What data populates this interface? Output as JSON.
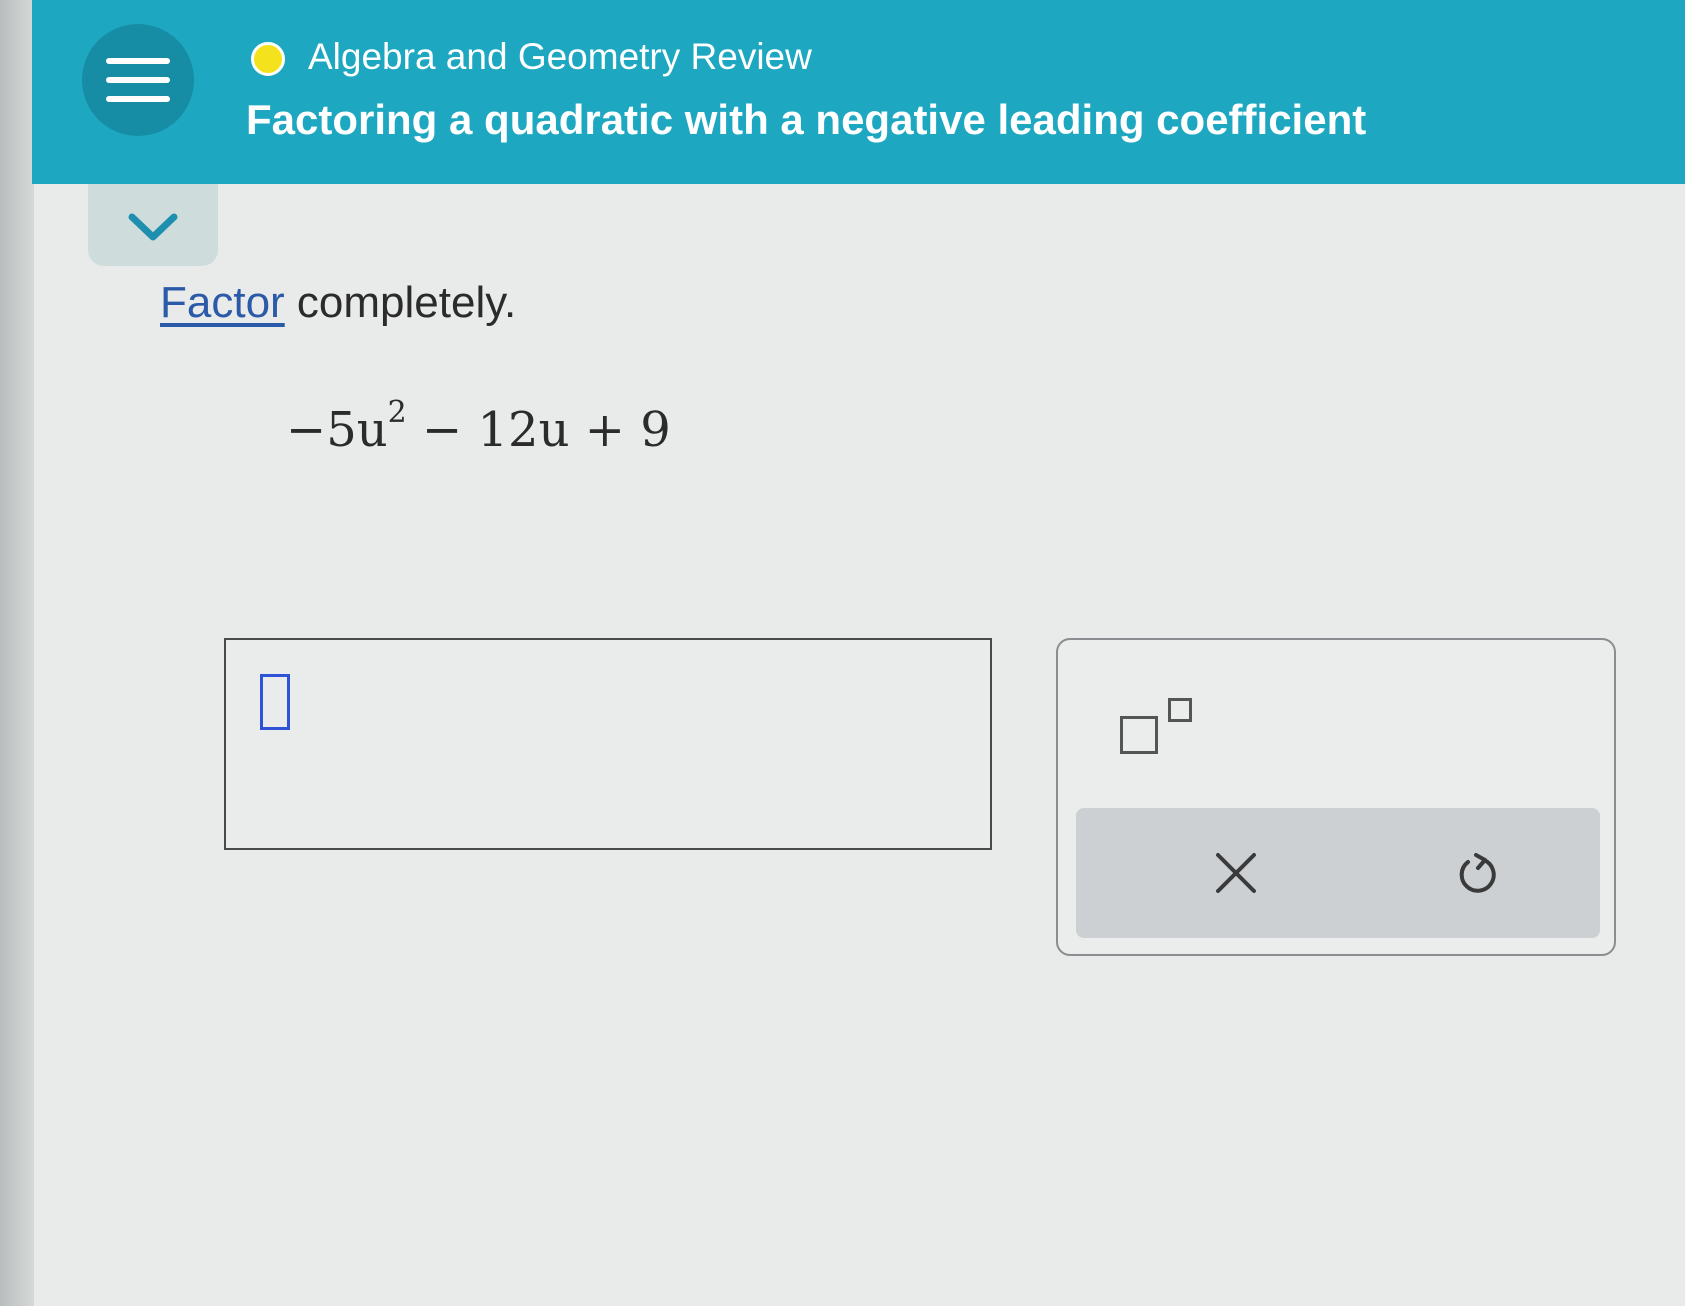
{
  "header": {
    "course_title": "Algebra and Geometry Review",
    "lesson_title": "Factoring a quadratic with a negative leading coefficient",
    "menu_icon": "hamburger-menu-icon",
    "status_icon": "yellow-status-dot",
    "colors": {
      "banner": "#1da7c1",
      "menu_button": "#168da4",
      "status_dot": "#f3e21c"
    }
  },
  "collapse_icon": "chevron-down-icon",
  "problem": {
    "prompt_term": "Factor",
    "prompt_rest": " completely.",
    "expression": {
      "lead": "−5u",
      "exponent": "2",
      "rest": " − 12u + 9"
    }
  },
  "answer": {
    "value": ""
  },
  "keypad": {
    "exponent_icon": "superscript-template-icon",
    "clear_icon": "x-icon",
    "undo_icon": "undo-icon"
  }
}
